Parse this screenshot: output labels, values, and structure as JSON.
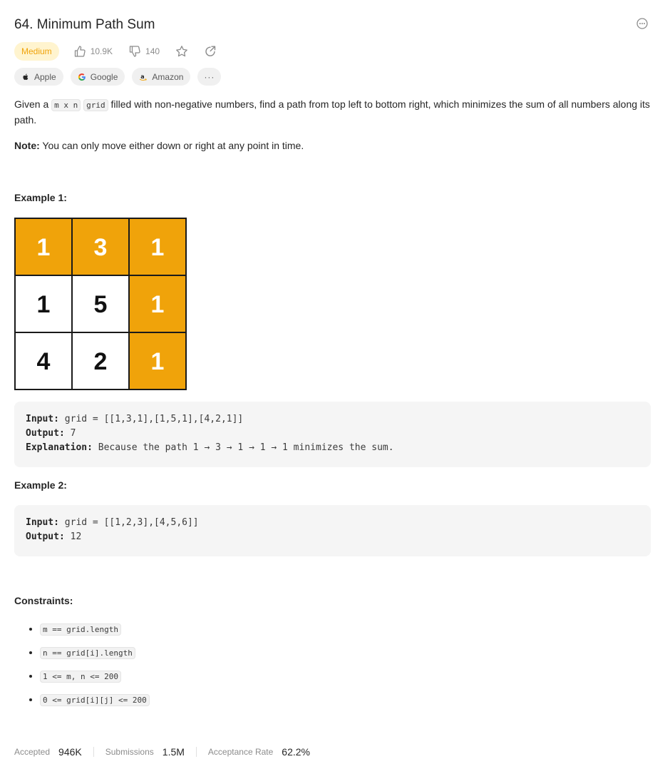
{
  "problem": {
    "title": "64. Minimum Path Sum",
    "difficulty": "Medium",
    "likes": "10.9K",
    "dislikes": "140"
  },
  "tags": [
    {
      "label": "Apple",
      "icon": "apple-icon"
    },
    {
      "label": "Google",
      "icon": "google-icon"
    },
    {
      "label": "Amazon",
      "icon": "amazon-icon"
    },
    {
      "label": "···",
      "icon": "more-icon"
    }
  ],
  "description": {
    "part1": "Given a ",
    "code1": "m x n",
    "code2": "grid",
    "part2": " filled with non-negative numbers, find a path from top left to bottom right, which minimizes the sum of all numbers along its path.",
    "note_label": "Note:",
    "note_text": " You can only move either down or right at any point in time."
  },
  "example1": {
    "heading": "Example 1:",
    "input_label": "Input:",
    "input_value": " grid = [[1,3,1],[1,5,1],[4,2,1]]",
    "output_label": "Output:",
    "output_value": " 7",
    "explanation_label": "Explanation:",
    "explanation_value": " Because the path 1 → 3 → 1 → 1 → 1 minimizes the sum."
  },
  "grid_figure": {
    "cells": [
      [
        "1",
        "3",
        "1"
      ],
      [
        "1",
        "5",
        "1"
      ],
      [
        "4",
        "2",
        "1"
      ]
    ],
    "path": [
      [
        0,
        0
      ],
      [
        0,
        1
      ],
      [
        0,
        2
      ],
      [
        1,
        2
      ],
      [
        2,
        2
      ]
    ],
    "highlight_color": "#f0a30a",
    "plain_color": "#ffffff"
  },
  "example2": {
    "heading": "Example 2:",
    "input_label": "Input:",
    "input_value": " grid = [[1,2,3],[4,5,6]]",
    "output_label": "Output:",
    "output_value": " 12"
  },
  "constraints": {
    "heading": "Constraints:",
    "items": [
      "m == grid.length",
      "n == grid[i].length",
      "1 <= m, n <= 200",
      "0 <= grid[i][j] <= 200"
    ]
  },
  "stats": {
    "accepted_label": "Accepted",
    "accepted_value": "946K",
    "submissions_label": "Submissions",
    "submissions_value": "1.5M",
    "rate_label": "Acceptance Rate",
    "rate_value": "62.2%"
  },
  "colors": {
    "accent": "#f0a30a",
    "difficulty_bg": "#fff4cf"
  }
}
